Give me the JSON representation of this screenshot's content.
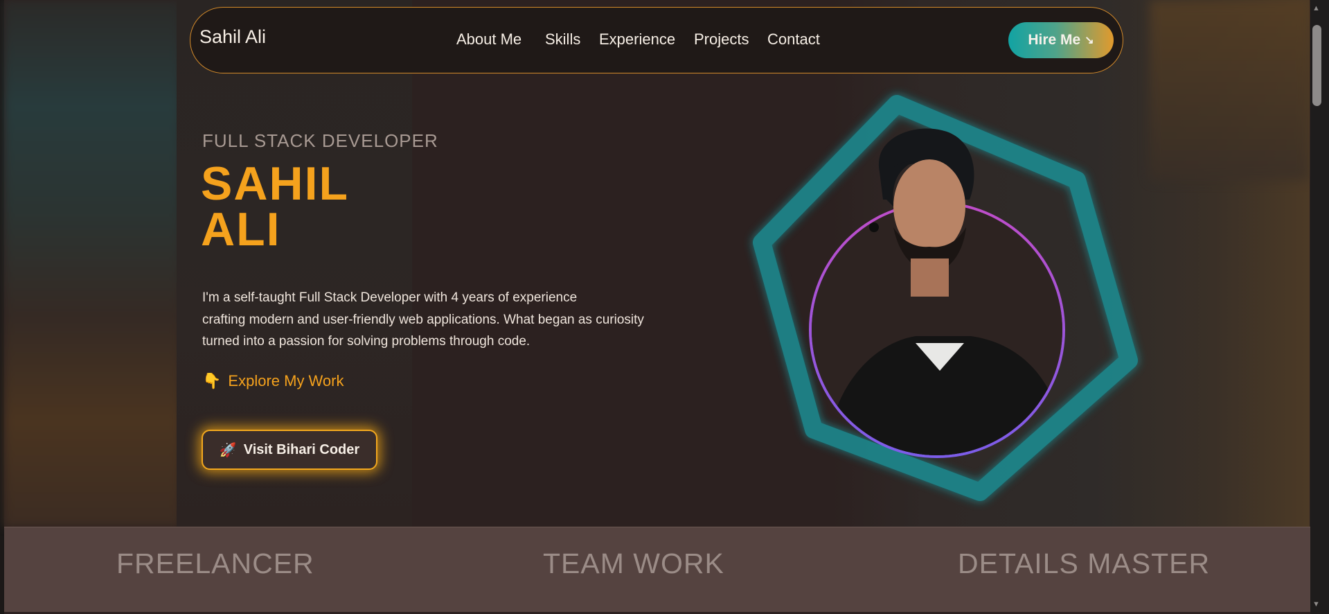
{
  "nav": {
    "brand": "Sahil Ali",
    "items": [
      "About Me",
      "Skills",
      "Experience",
      "Projects",
      "Contact"
    ],
    "hire_label": "Hire Me",
    "hire_icon": "↘"
  },
  "hero": {
    "subtitle": "FULL STACK DEVELOPER",
    "name_line1": "SAHIL",
    "name_line2": "ALI",
    "bio_line1": "I'm a self-taught Full Stack Developer with 4 years of experience",
    "bio_line2": "crafting modern and user-friendly web applications. What began as curiosity",
    "bio_line3": "turned into a passion for solving problems through code.",
    "explore_icon": "👇",
    "explore_label": "Explore My Work",
    "visit_icon": "🚀",
    "visit_label": "Visit Bihari Coder"
  },
  "band": [
    "FREELANCER",
    "TEAM WORK",
    "DETAILS MASTER"
  ],
  "colors": {
    "accent": "#f5a21d",
    "teal": "#12a3a3",
    "ring_pink": "#e04fc2",
    "ring_blue": "#5a6ef0",
    "background": "#2c2120"
  }
}
